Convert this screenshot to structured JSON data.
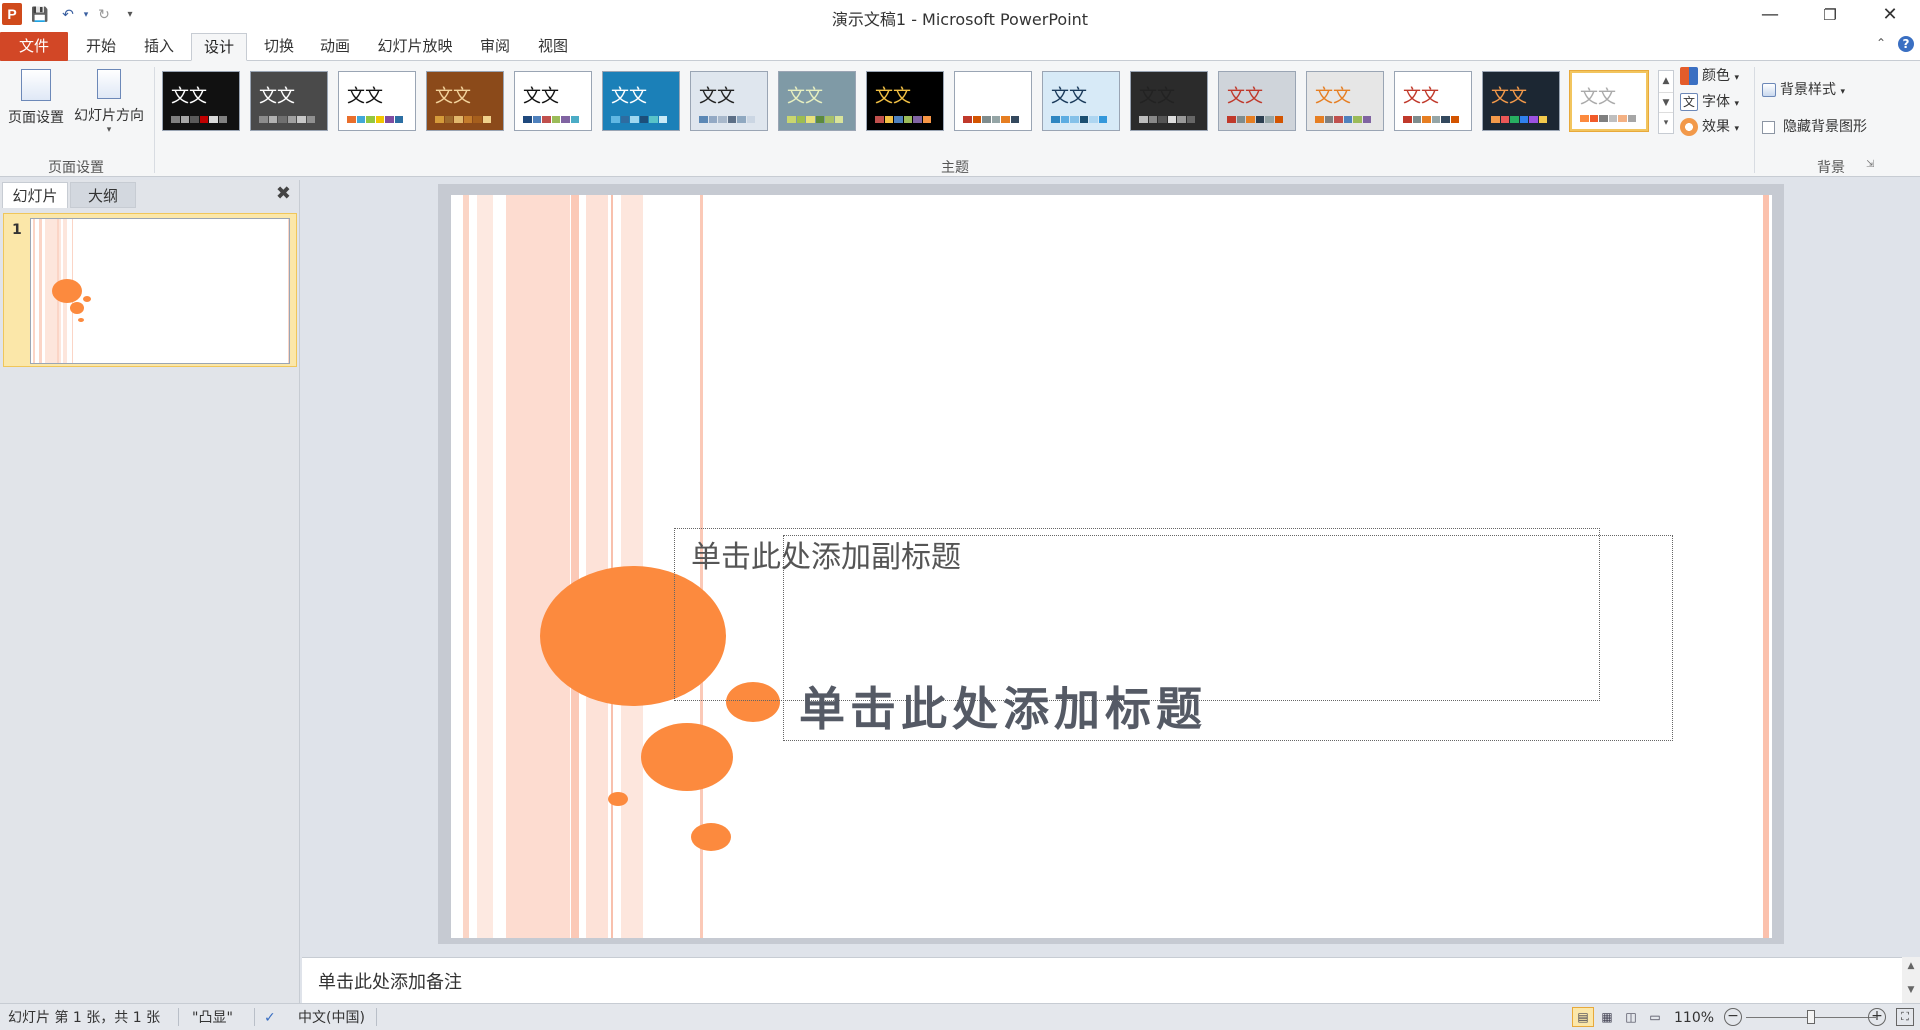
{
  "window": {
    "title": "演示文稿1 - Microsoft PowerPoint",
    "app_icon": "P"
  },
  "quick_access": {
    "save_icon": "save-icon",
    "undo_icon": "undo-icon",
    "redo_icon": "redo-icon",
    "customize_icon": "customize-icon"
  },
  "tabs": [
    {
      "label": "文件"
    },
    {
      "label": "开始"
    },
    {
      "label": "插入"
    },
    {
      "label": "设计"
    },
    {
      "label": "切换"
    },
    {
      "label": "动画"
    },
    {
      "label": "幻灯片放映"
    },
    {
      "label": "审阅"
    },
    {
      "label": "视图"
    }
  ],
  "active_tab": "设计",
  "ribbon": {
    "page_setup_group": {
      "label": "页面设置",
      "page_setup_button": "页面设置",
      "orientation_button": "幻灯片方向"
    },
    "themes_group": {
      "label": "主题",
      "theme_sample_text": "文文",
      "themes": [
        {
          "bg": "#111111",
          "fg": "#ffffff",
          "sw": [
            "#7f7f7f",
            "#a6a6a6",
            "#595959",
            "#c00000",
            "#d9d9d9",
            "#808080"
          ]
        },
        {
          "bg": "#4a4a4a",
          "fg": "#ffffff",
          "sw": [
            "#8c8c8c",
            "#b2b2b2",
            "#6f6f6f",
            "#a0a0a0",
            "#c8c8c8",
            "#909090"
          ]
        },
        {
          "bg": "#ffffff",
          "fg": "#111111",
          "sw": [
            "#e96f2c",
            "#41a8d8",
            "#93c73f",
            "#f2c600",
            "#7f4ca1",
            "#2d6fa3"
          ]
        },
        {
          "bg": "#8b4a1a",
          "fg": "#f3d39c",
          "sw": [
            "#d59b3a",
            "#9e6a2d",
            "#e2b86c",
            "#c47c2c",
            "#a65f1d",
            "#f0d28c"
          ]
        },
        {
          "bg": "#ffffff",
          "fg": "#111111",
          "sw": [
            "#1f497d",
            "#4f81bd",
            "#c0504d",
            "#9bbb59",
            "#8064a2",
            "#4bacc6"
          ]
        },
        {
          "bg": "#1b80b8",
          "fg": "#ffffff",
          "sw": [
            "#60b7e3",
            "#2e6ca0",
            "#9fd8f0",
            "#1c4e79",
            "#58c3c8",
            "#c9eaf7"
          ]
        },
        {
          "bg": "#dfe6ee",
          "fg": "#222222",
          "sw": [
            "#5b88b5",
            "#93a9c4",
            "#a8b8cb",
            "#5c6f86",
            "#8fa8c0",
            "#cbd6e3"
          ]
        },
        {
          "bg": "#7f9aa6",
          "fg": "#e8f0c0",
          "sw": [
            "#c9d66f",
            "#9dbd4f",
            "#e8e27c",
            "#5c8a3d",
            "#a6c06a",
            "#d9e49a"
          ]
        },
        {
          "bg": "#000000",
          "fg": "#f2c044",
          "sw": [
            "#c0504d",
            "#f2c044",
            "#4f81bd",
            "#9bbb59",
            "#8064a2",
            "#f79646"
          ]
        },
        {
          "bg": "#ffffff",
          "fg": "#ffffff",
          "sw": [
            "#c0392b",
            "#d35400",
            "#7f8c8d",
            "#95a5a6",
            "#e67e22",
            "#34495e"
          ]
        },
        {
          "bg": "#d7eaf7",
          "fg": "#1a3a5a",
          "sw": [
            "#2e86c1",
            "#5dade2",
            "#85c1e9",
            "#1b4f72",
            "#aed6f1",
            "#3498db"
          ]
        },
        {
          "bg": "#2b2b2b",
          "fg": "#222222",
          "sw": [
            "#bdbdbd",
            "#888888",
            "#555555",
            "#dddddd",
            "#999999",
            "#666666"
          ]
        },
        {
          "bg": "#cfd4da",
          "fg": "#c0392b",
          "sw": [
            "#c0392b",
            "#7f8c8d",
            "#e67e22",
            "#2c3e50",
            "#95a5a6",
            "#d35400"
          ]
        },
        {
          "bg": "#e6e6e6",
          "fg": "#e67e22",
          "sw": [
            "#e67e22",
            "#7f7f7f",
            "#c0504d",
            "#4f81bd",
            "#9bbb59",
            "#8064a2"
          ]
        },
        {
          "bg": "#ffffff",
          "fg": "#c0392b",
          "sw": [
            "#c0392b",
            "#7f8c8d",
            "#e67e22",
            "#95a5a6",
            "#34495e",
            "#d35400"
          ]
        },
        {
          "bg": "#1c2733",
          "fg": "#f2994a",
          "sw": [
            "#f2994a",
            "#eb5757",
            "#27ae60",
            "#2f80ed",
            "#9b51e0",
            "#f2c94c"
          ]
        },
        {
          "bg": "#ffffff",
          "fg": "#aaaaaa",
          "sw": [
            "#fc8a3e",
            "#f15a29",
            "#7f7f7f",
            "#bfbfbf",
            "#f4b183",
            "#a6a6a6"
          ]
        }
      ],
      "selected_index": 16,
      "colors_button": "颜色",
      "fonts_button": "字体",
      "effects_button": "效果"
    },
    "background_group": {
      "label": "背景",
      "background_styles_button": "背景样式",
      "hide_background_graphics": "隐藏背景图形"
    }
  },
  "left_pane": {
    "tabs": [
      {
        "label": "幻灯片"
      },
      {
        "label": "大纲"
      }
    ],
    "slide_number": "1"
  },
  "slide": {
    "subtitle_placeholder": "单击此处添加副标题",
    "title_placeholder": "单击此处添加标题",
    "accent_color": "#fc8a3e",
    "stripe_color": "#fbd5c6"
  },
  "notes": {
    "placeholder": "单击此处添加备注"
  },
  "status_bar": {
    "slide_info": "幻灯片 第 1 张，共 1 张",
    "theme_name": "\"凸显\"",
    "language": "中文(中国)",
    "zoom_label": "110%",
    "zoom_fraction": 0.5
  }
}
